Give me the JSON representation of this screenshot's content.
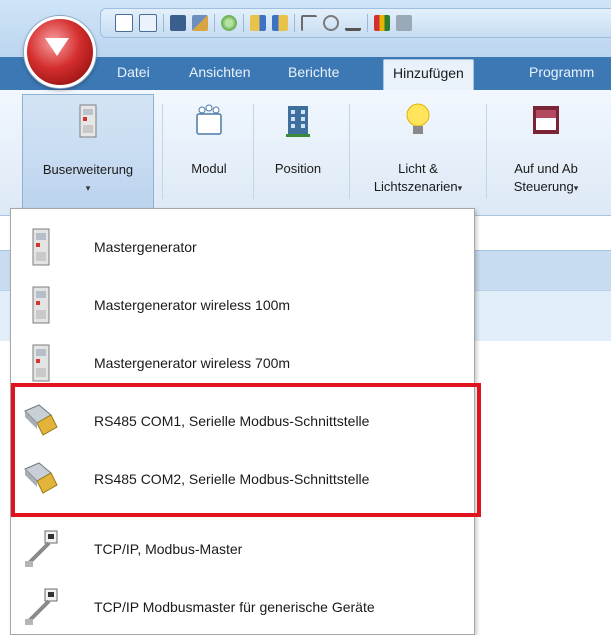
{
  "tabs": [
    {
      "label": "Datei"
    },
    {
      "label": "Ansichten"
    },
    {
      "label": "Berichte"
    },
    {
      "label": "Hinzufügen"
    },
    {
      "label": "Programm"
    }
  ],
  "ribbon": {
    "buttons": [
      {
        "label": "Buserweiterung",
        "arrow": "▾"
      },
      {
        "label": "Modul"
      },
      {
        "label": "Position"
      },
      {
        "label1": "Licht &",
        "label2": "Lichtszenarien",
        "arrow": "▾"
      },
      {
        "label1": "Auf und Ab",
        "label2": "Steuerung",
        "arrow": "▾"
      }
    ]
  },
  "menu": {
    "items": [
      {
        "label": "Mastergenerator",
        "icon": "module-icon"
      },
      {
        "label": "Mastergenerator wireless 100m",
        "icon": "module-icon"
      },
      {
        "label": "Mastergenerator wireless 700m",
        "icon": "module-icon"
      },
      {
        "label": "RS485 COM1, Serielle Modbus-Schnittstelle",
        "icon": "serial-connector-icon"
      },
      {
        "label": "RS485 COM2, Serielle Modbus-Schnittstelle",
        "icon": "serial-connector-icon"
      },
      {
        "label": "TCP/IP, Modbus-Master",
        "icon": "network-cable-icon"
      },
      {
        "label": "TCP/IP Modbusmaster für generische Geräte",
        "icon": "network-cable-icon"
      }
    ]
  },
  "colors": {
    "tabbar": "#3c78b4",
    "highlight": "#e0141e",
    "logo": "#d42e2e"
  }
}
